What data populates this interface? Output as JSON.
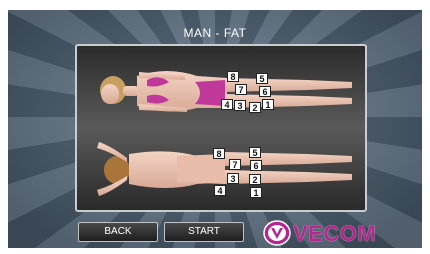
{
  "screen": {
    "title": "MAN - FAT"
  },
  "body_views": {
    "front_zones": [
      "8",
      "5",
      "7",
      "6",
      "4",
      "3",
      "2",
      "1"
    ],
    "back_zones": [
      "8",
      "5",
      "7",
      "6",
      "4",
      "3",
      "2",
      "1"
    ]
  },
  "buttons": {
    "back_label": "BACK",
    "start_label": "START"
  },
  "brand": {
    "logo_text": "VECOM",
    "logo_icon": "vecom-v-icon",
    "accent_color": "#b5278f"
  }
}
